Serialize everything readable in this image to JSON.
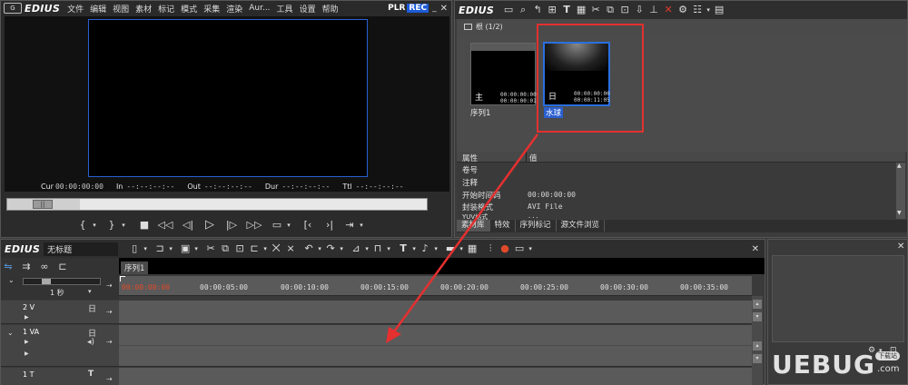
{
  "app": {
    "logo": "EDIUS",
    "menu": [
      "文件",
      "编辑",
      "视图",
      "素材",
      "标记",
      "模式",
      "采集",
      "渲染",
      "Aur...",
      "工具",
      "设置",
      "帮助"
    ],
    "plr_label": "PLR",
    "rec_label": "REC"
  },
  "player": {
    "cur_label": "Cur",
    "cur_value": "00:00:00:00",
    "in_label": "In",
    "in_value": "--:--:--:--",
    "out_label": "Out",
    "out_value": "--:--:--:--",
    "dur_label": "Dur",
    "dur_value": "--:--:--:--",
    "ttl_label": "Ttl",
    "ttl_value": "--:--:--:--",
    "scrub_handle": "||",
    "controls": [
      "{",
      "}",
      "■",
      "◁◁",
      "◁|",
      "▷",
      "|▷",
      "▷▷",
      "▭",
      "[‹",
      "›|",
      "⇥"
    ]
  },
  "bin": {
    "logo": "EDIUS",
    "folder_label": "根 (1/2)",
    "clips": [
      {
        "name": "序列1",
        "tc1": "00:00:00:00",
        "tc2": "00:00:00:01",
        "badge": "主"
      },
      {
        "name": "水球",
        "tc1": "00:00:00:00",
        "tc2": "00:00:11:05",
        "badge": "日"
      }
    ],
    "props_header": {
      "col1": "属性",
      "col2": "值"
    },
    "props": [
      {
        "label": "卷号",
        "value": ""
      },
      {
        "label": "注释",
        "value": ""
      },
      {
        "label": "开始时间码",
        "value": "00:00:00:00"
      },
      {
        "label": "封装格式",
        "value": "AVI File"
      },
      {
        "label": "YUV格式",
        "value": "..."
      }
    ],
    "tabs": [
      "素材库",
      "特效",
      "序列标记",
      "源文件浏览"
    ]
  },
  "timeline": {
    "logo": "EDIUS",
    "project_name": "无标题",
    "sequence_tab": "序列1",
    "zoom_label": "1 秒",
    "ruler": [
      "00:00:00:00",
      "00:00:05:00",
      "00:00:10:00",
      "00:00:15:00",
      "00:00:20:00",
      "00:00:25:00",
      "00:00:30:00",
      "00:00:35:00"
    ],
    "tracks": [
      {
        "name": "2 V",
        "icon": "日"
      },
      {
        "name": "1 VA",
        "icon": "日"
      },
      {
        "name": "1 T",
        "icon": "T"
      }
    ]
  },
  "watermark": {
    "text": "UEBUG",
    "suffix": ".com",
    "badge": "下载站"
  },
  "colors": {
    "accent_blue": "#2a5fd0",
    "annotation_red": "#e53030",
    "rec_blue": "#1d5bd8",
    "timecode_red": "#e04a2a"
  }
}
